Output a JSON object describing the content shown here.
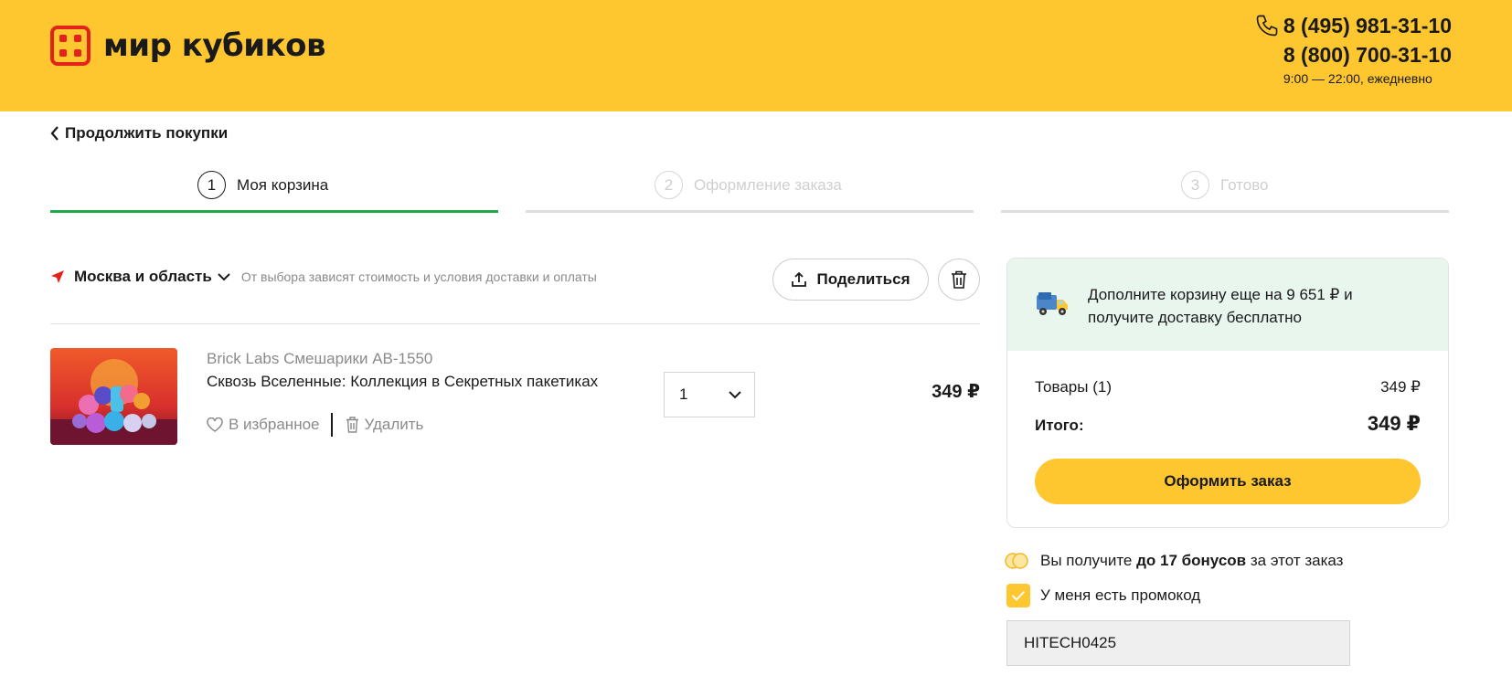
{
  "header": {
    "logo_text": "мир кубиков",
    "phone1": "8 (495) 981-31-10",
    "phone2": "8 (800) 700-31-10",
    "hours": "9:00 — 22:00, ежедневно"
  },
  "back_link": "Продолжить покупки",
  "steps": [
    {
      "num": "1",
      "label": "Моя корзина"
    },
    {
      "num": "2",
      "label": "Оформление заказа"
    },
    {
      "num": "3",
      "label": "Готово"
    }
  ],
  "region": {
    "city": "Москва и область",
    "hint": "От выбора зависят стоимость и условия доставки и оплаты"
  },
  "share_label": "Поделиться",
  "product": {
    "brand": "Brick Labs Смешарики AB-1550",
    "name": "Сквозь Вселенные: Коллекция в Секретных пакетиках",
    "favorite_label": "В избранное",
    "delete_label": "Удалить",
    "quantity": "1",
    "price": "349 ₽"
  },
  "summary": {
    "free_delivery_text": "Дополните корзину еще на 9 651 ₽ и получите доставку бесплатно",
    "goods_label": "Товары (1)",
    "goods_value": "349 ₽",
    "total_label": "Итого:",
    "total_value": "349 ₽",
    "order_button": "Оформить заказ"
  },
  "bonus": {
    "prefix": "Вы получите ",
    "bold": "до 17 бонусов",
    "suffix": " за этот заказ"
  },
  "promo": {
    "label": "У меня есть промокод",
    "checked": true,
    "value": "HITECH0425"
  },
  "colors": {
    "brand_yellow": "#fec62f",
    "logo_red": "#e3231b",
    "active_step": "#1ea84a",
    "promo_bg": "#e8f6ee"
  }
}
